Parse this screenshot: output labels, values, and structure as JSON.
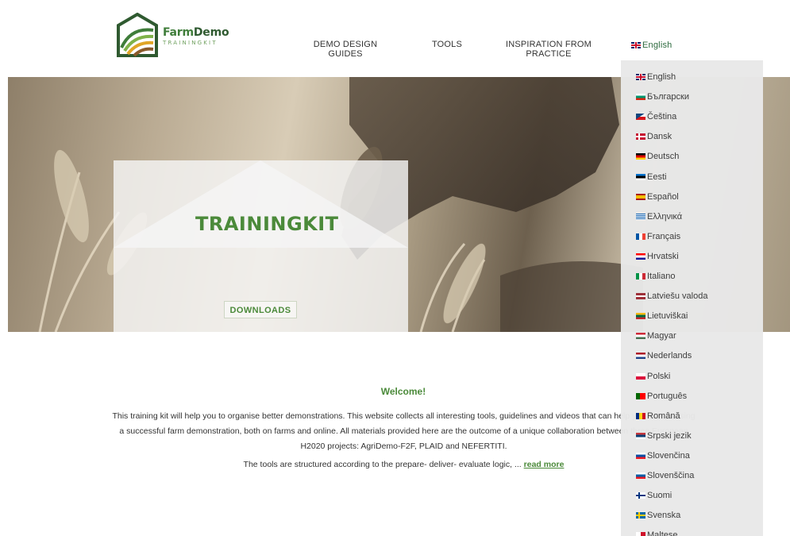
{
  "logo": {
    "title_a": "Farm",
    "title_b": "Demo",
    "subtitle": "TRAININGKIT"
  },
  "nav": {
    "demo_design_line1": "DEMO DESIGN",
    "demo_design_line2": "GUIDES",
    "tools": "TOOLS",
    "inspiration_line1": "INSPIRATION FROM",
    "inspiration_line2": "PRACTICE",
    "language_current": "English"
  },
  "hero": {
    "title": "TRAININGKIT",
    "button": "DOWNLOADS"
  },
  "welcome": {
    "title": "Welcome!",
    "paragraph": "This training kit will help you to organise better demonstrations. This website collects all interesting tools, guidelines and videos that can help you in organising a successful farm demonstration, both on farms and online. All materials provided here are the outcome of a unique collaboration between three European H2020 projects: AgriDemo-F2F, PLAID and NEFERTITI.",
    "more_text": "The tools are structured according to the prepare- deliver- evaluate logic, ... ",
    "more_link": "read more"
  },
  "languages": [
    {
      "label": "English",
      "flag": "gb"
    },
    {
      "label": "Български",
      "flag": "bg"
    },
    {
      "label": "Čeština",
      "flag": "cz"
    },
    {
      "label": "Dansk",
      "flag": "dk"
    },
    {
      "label": "Deutsch",
      "flag": "de"
    },
    {
      "label": "Eesti",
      "flag": "ee"
    },
    {
      "label": "Español",
      "flag": "es"
    },
    {
      "label": "Ελληνικά",
      "flag": "gr"
    },
    {
      "label": "Français",
      "flag": "fr"
    },
    {
      "label": "Hrvatski",
      "flag": "hr"
    },
    {
      "label": "Italiano",
      "flag": "it"
    },
    {
      "label": "Latviešu valoda",
      "flag": "lv"
    },
    {
      "label": "Lietuviškai",
      "flag": "lt"
    },
    {
      "label": "Magyar",
      "flag": "hu"
    },
    {
      "label": "Nederlands",
      "flag": "nl"
    },
    {
      "label": "Polski",
      "flag": "pl"
    },
    {
      "label": "Português",
      "flag": "pt"
    },
    {
      "label": "Română",
      "flag": "ro"
    },
    {
      "label": "Srpski jezik",
      "flag": "rs"
    },
    {
      "label": "Slovenčina",
      "flag": "sk"
    },
    {
      "label": "Slovenščina",
      "flag": "si"
    },
    {
      "label": "Suomi",
      "flag": "fi"
    },
    {
      "label": "Svenska",
      "flag": "se"
    },
    {
      "label": "Maltese",
      "flag": "mt"
    }
  ],
  "colors": {
    "brand_green": "#4b8a3a",
    "dark_green": "#2f5a30",
    "menu_bg": "#e8e8e8"
  }
}
